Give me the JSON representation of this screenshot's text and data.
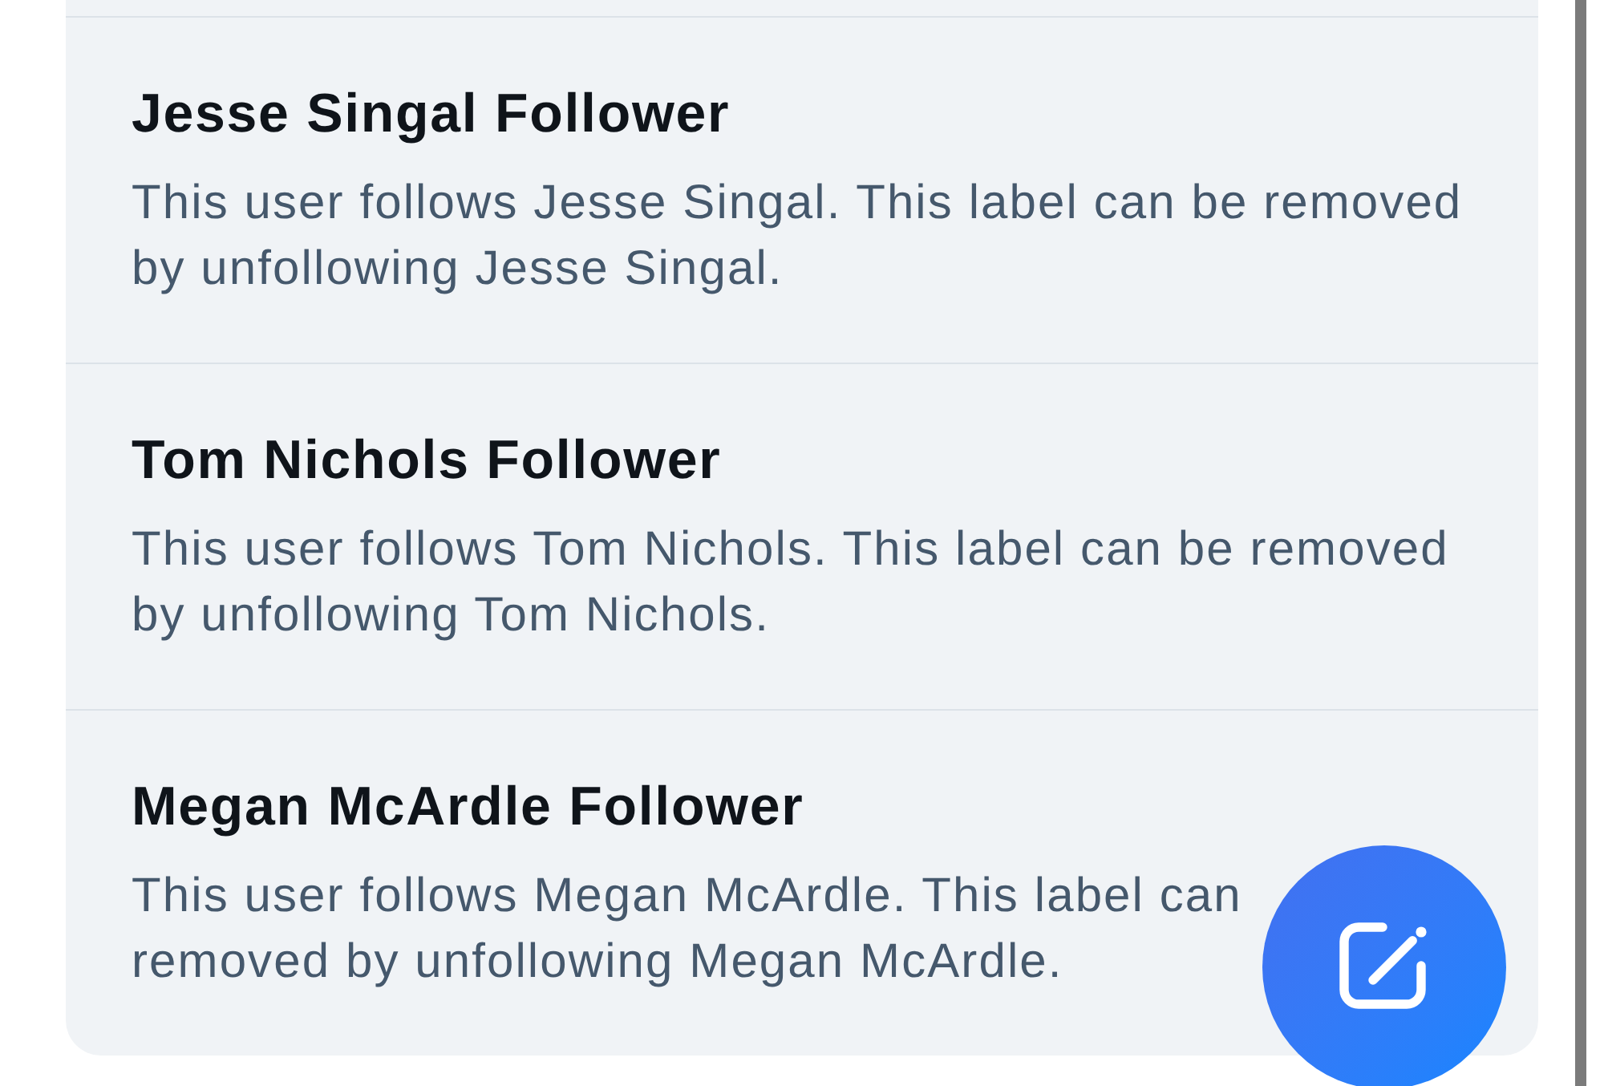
{
  "labels": [
    {
      "title": "Jesse Singal Follower",
      "description_lines": [
        "This user follows Jesse Singal. This label can be removed",
        "by unfollowing Jesse Singal."
      ]
    },
    {
      "title": "Tom Nichols Follower",
      "description_lines": [
        "This user follows Tom Nichols. This label can be removed",
        "by unfollowing Tom Nichols."
      ]
    },
    {
      "title": "Megan McArdle Follower",
      "description_lines": [
        "This user follows Megan McArdle. This label can",
        "removed by unfollowing Megan McArdle."
      ]
    }
  ]
}
